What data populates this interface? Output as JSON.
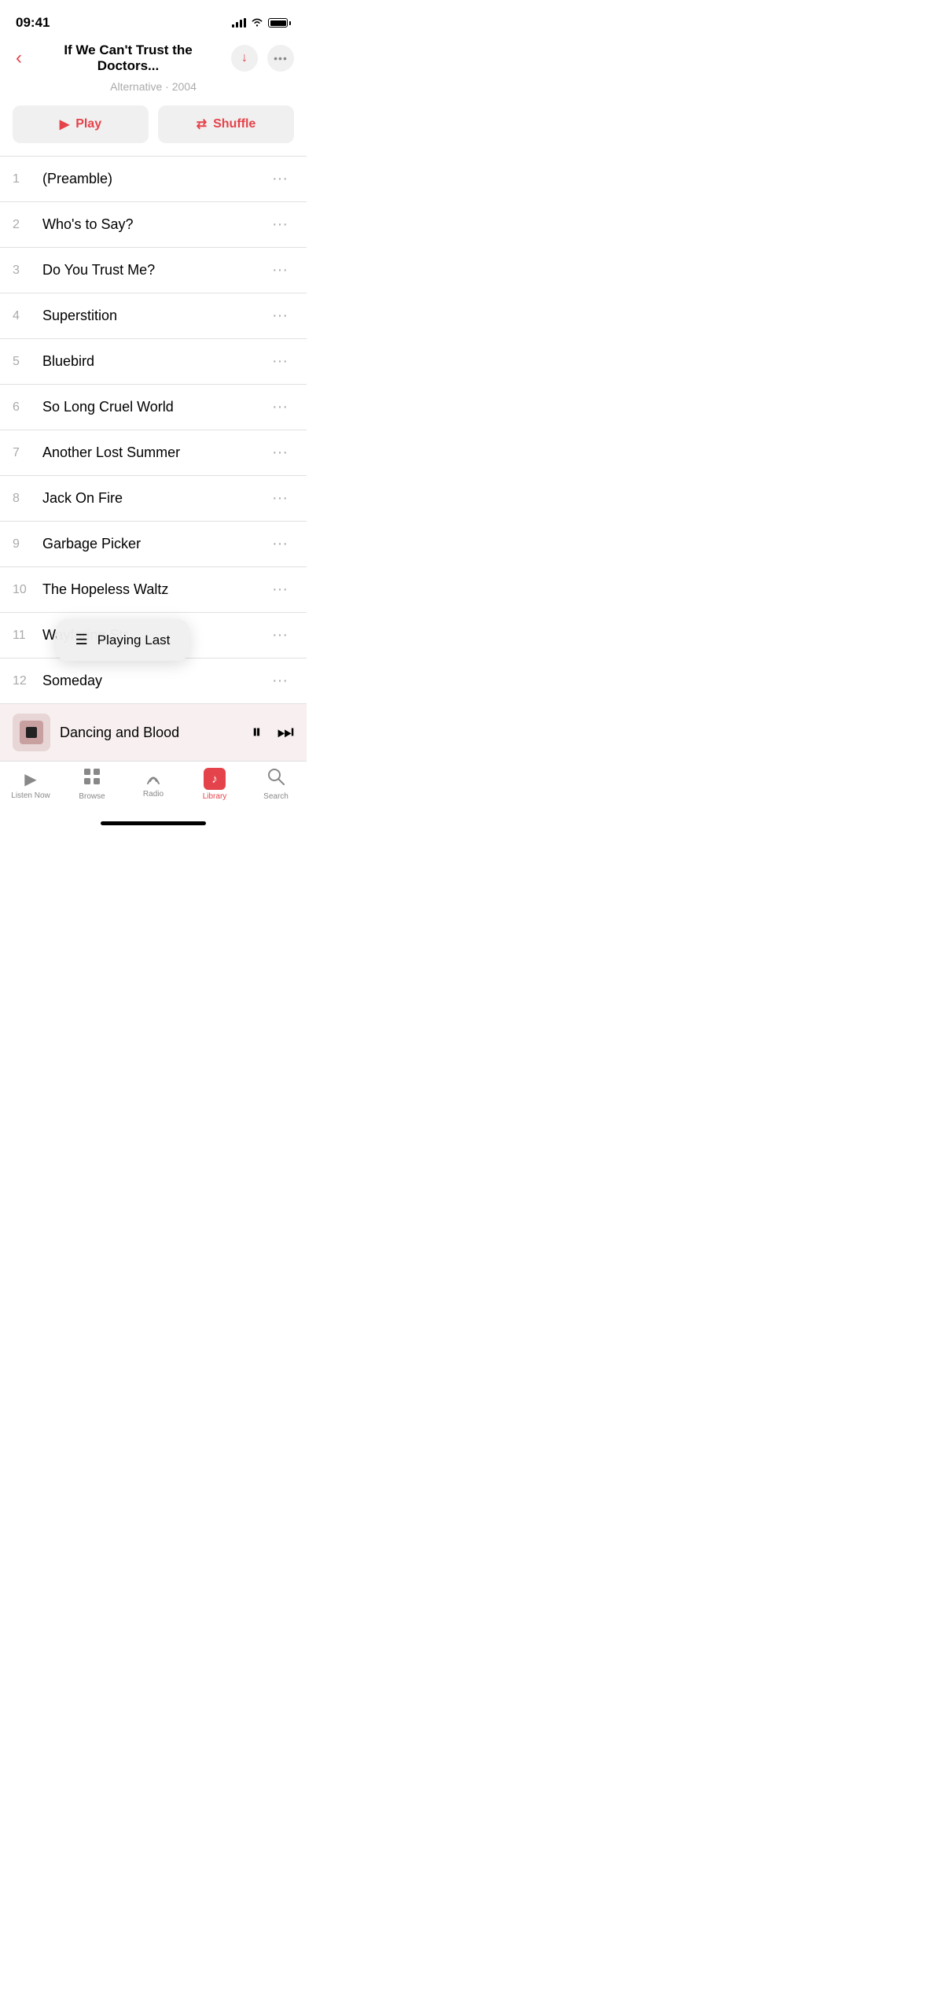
{
  "statusBar": {
    "time": "09:41"
  },
  "header": {
    "title": "If We Can't Trust the Doctors...",
    "subtitle": "Alternative · 2004"
  },
  "buttons": {
    "play": "Play",
    "shuffle": "Shuffle"
  },
  "tracks": [
    {
      "number": "1",
      "title": "(Preamble)"
    },
    {
      "number": "2",
      "title": "Who's to Say?"
    },
    {
      "number": "3",
      "title": "Do You Trust Me?"
    },
    {
      "number": "4",
      "title": "Superstition"
    },
    {
      "number": "5",
      "title": "Bluebird"
    },
    {
      "number": "6",
      "title": "So Long Cruel World"
    },
    {
      "number": "7",
      "title": "Another Lost Summer"
    },
    {
      "number": "8",
      "title": "Jack On Fire"
    },
    {
      "number": "9",
      "title": "Garbage Picker"
    },
    {
      "number": "10",
      "title": "The Hopeless Waltz"
    },
    {
      "number": "11",
      "title": "Wayfaring Str..."
    },
    {
      "number": "12",
      "title": "Someday"
    }
  ],
  "tooltip": {
    "label": "Playing Last"
  },
  "nowPlaying": {
    "title": "Dancing and Blood",
    "artIcon": "▪"
  },
  "tabBar": {
    "items": [
      {
        "id": "listen-now",
        "label": "Listen Now",
        "icon": "▶"
      },
      {
        "id": "browse",
        "label": "Browse",
        "icon": "⊞"
      },
      {
        "id": "radio",
        "label": "Radio",
        "icon": "📻"
      },
      {
        "id": "library",
        "label": "Library",
        "icon": "♪",
        "active": true
      },
      {
        "id": "search",
        "label": "Search",
        "icon": "🔍"
      }
    ]
  }
}
